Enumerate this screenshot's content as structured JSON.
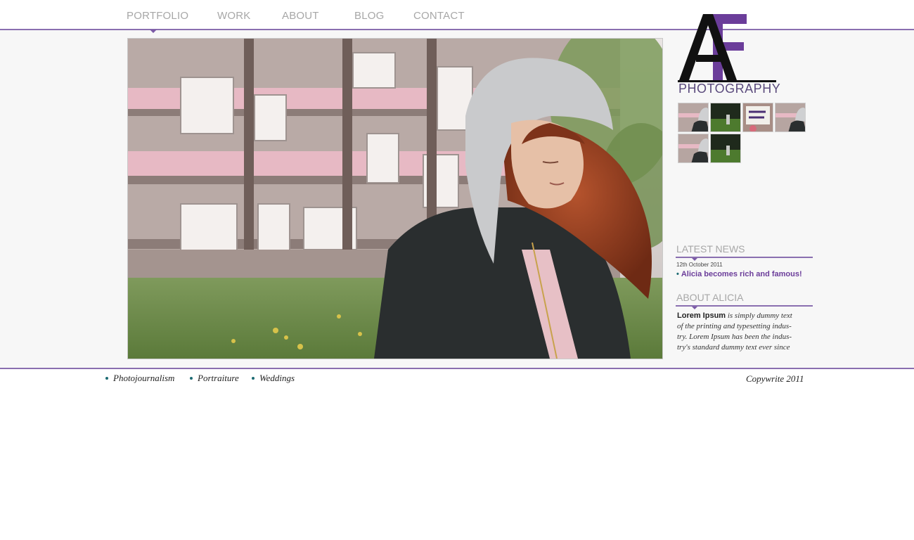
{
  "nav": {
    "items": [
      {
        "label": "PORTFOLIO"
      },
      {
        "label": "WORK"
      },
      {
        "label": "ABOUT"
      },
      {
        "label": "BLOG"
      },
      {
        "label": "CONTACT"
      }
    ],
    "active": "PORTFOLIO"
  },
  "hero": {
    "description_icon": "photo-hooded-woman"
  },
  "logo": {
    "letters": "AF",
    "text": "PHOTOGRAPHY"
  },
  "thumbnails": [
    {
      "icon": "thumb-hooded-woman"
    },
    {
      "icon": "thumb-park"
    },
    {
      "icon": "thumb-protest-sign"
    },
    {
      "icon": "thumb-hooded-woman"
    },
    {
      "icon": "thumb-hooded-woman"
    },
    {
      "icon": "thumb-park"
    }
  ],
  "latest_news": {
    "title": "LATEST NEWS",
    "date": "12th October 2011",
    "headline": "Alicia becomes rich and famous!"
  },
  "about": {
    "title": "ABOUT ALICIA",
    "lead": "Lorem Ipsum",
    "body_line1": " is simply dummy text",
    "body_line2": "of the printing and typesetting indus-",
    "body_line3": "try. Lorem Ipsum has been the indus-",
    "body_line4": "try's standard dummy text ever since"
  },
  "footer": {
    "links": [
      {
        "label": "Photojournalism"
      },
      {
        "label": "Portraiture"
      },
      {
        "label": "Weddings"
      }
    ],
    "copyright": "Copywrite 2011"
  },
  "colors": {
    "accent": "#8a6fb0",
    "headline": "#6b3d9a",
    "bullet": "#1d6b73",
    "nav_text": "#a7a7a7"
  }
}
